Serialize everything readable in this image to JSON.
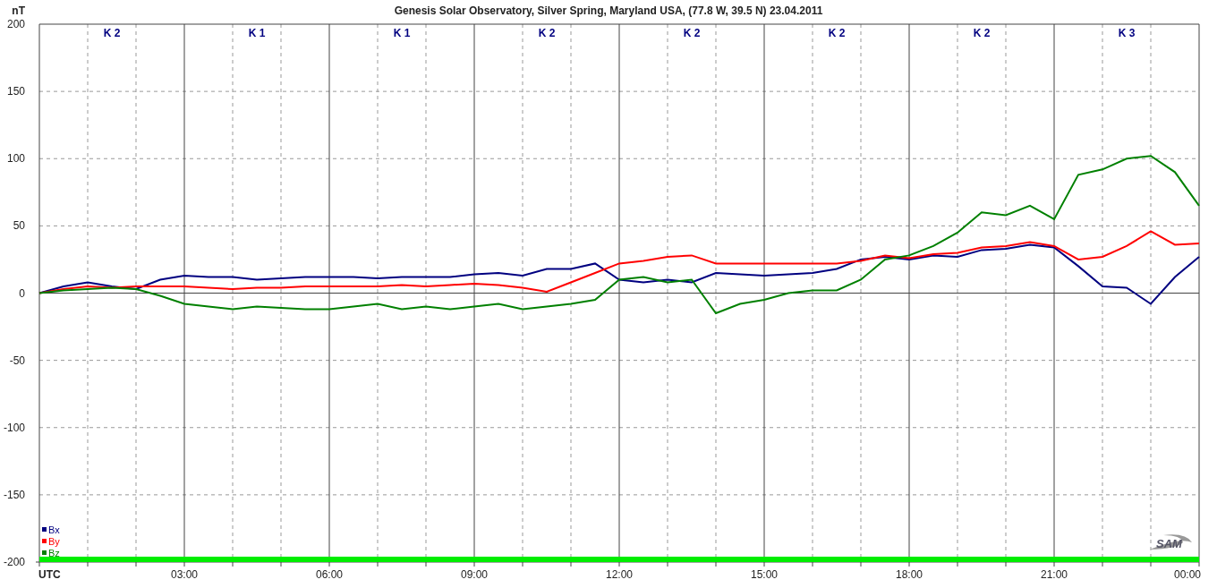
{
  "chart_data": {
    "type": "line",
    "title": "Genesis Solar Observatory, Silver Spring, Maryland USA, (77.8 W, 39.5 N)  23.04.2011",
    "ylabel": "nT",
    "x": [
      0,
      0.5,
      1,
      1.5,
      2,
      2.5,
      3,
      3.5,
      4,
      4.5,
      5,
      5.5,
      6,
      6.5,
      7,
      7.5,
      8,
      8.5,
      9,
      9.5,
      10,
      10.5,
      11,
      11.5,
      12,
      12.5,
      13,
      13.5,
      14,
      14.5,
      15,
      15.5,
      16,
      16.5,
      17,
      17.5,
      18,
      18.5,
      19,
      19.5,
      20,
      20.5,
      21,
      21.5,
      22,
      22.5,
      23,
      23.5,
      24
    ],
    "series": [
      {
        "name": "Bx",
        "color": "#000080",
        "values": [
          0,
          5,
          8,
          5,
          3,
          10,
          13,
          12,
          12,
          10,
          11,
          12,
          12,
          12,
          11,
          12,
          12,
          12,
          14,
          15,
          13,
          18,
          18,
          22,
          10,
          8,
          10,
          8,
          15,
          14,
          13,
          14,
          15,
          18,
          25,
          27,
          25,
          28,
          27,
          32,
          33,
          36,
          34,
          20,
          5,
          4,
          -8,
          12,
          27
        ]
      },
      {
        "name": "By",
        "color": "#ff0000",
        "values": [
          0,
          3,
          5,
          4,
          5,
          5,
          5,
          4,
          3,
          4,
          4,
          5,
          5,
          5,
          5,
          6,
          5,
          6,
          7,
          6,
          4,
          1,
          8,
          15,
          22,
          24,
          27,
          28,
          22,
          22,
          22,
          22,
          22,
          22,
          24,
          28,
          26,
          29,
          30,
          34,
          35,
          38,
          35,
          25,
          27,
          35,
          46,
          36,
          37
        ]
      },
      {
        "name": "Bz",
        "color": "#008000",
        "values": [
          0,
          2,
          3,
          4,
          3,
          -2,
          -8,
          -10,
          -12,
          -10,
          -11,
          -12,
          -12,
          -10,
          -8,
          -12,
          -10,
          -12,
          -10,
          -8,
          -12,
          -10,
          -8,
          -5,
          10,
          12,
          8,
          10,
          -15,
          -8,
          -5,
          0,
          2,
          2,
          10,
          25,
          28,
          35,
          45,
          60,
          58,
          65,
          55,
          88,
          92,
          100,
          102,
          90,
          65
        ]
      }
    ],
    "xlim": [
      0,
      24
    ],
    "ylim": [
      -200,
      200
    ],
    "yticks": [
      -200,
      -150,
      -100,
      -50,
      0,
      50,
      100,
      150,
      200
    ],
    "grid": true,
    "legend": true,
    "bands": [
      {
        "axis": "y",
        "from": -200,
        "to": -196,
        "color": "#00ee00"
      }
    ],
    "xticks": [
      {
        "value": 0,
        "label": "UTC"
      },
      {
        "value": 3,
        "label": "03:00"
      },
      {
        "value": 6,
        "label": "06:00"
      },
      {
        "value": 9,
        "label": "09:00"
      },
      {
        "value": 12,
        "label": "12:00"
      },
      {
        "value": 15,
        "label": "15:00"
      },
      {
        "value": 18,
        "label": "18:00"
      },
      {
        "value": 21,
        "label": "21:00"
      },
      {
        "value": 24,
        "label": "00:00"
      }
    ],
    "annotations": [
      "K 2",
      "K 1",
      "K 1",
      "K 2",
      "K 2",
      "K 2",
      "K 2",
      "K 3"
    ]
  },
  "logo": {
    "text": "SAM"
  }
}
